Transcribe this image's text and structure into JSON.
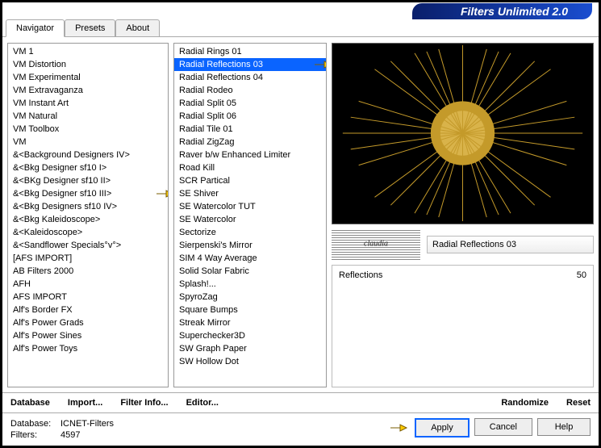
{
  "brand": "Filters Unlimited 2.0",
  "tabs": [
    "Navigator",
    "Presets",
    "About"
  ],
  "active_tab": "Navigator",
  "categories": [
    "VM 1",
    "VM Distortion",
    "VM Experimental",
    "VM Extravaganza",
    "VM Instant Art",
    "VM Natural",
    "VM Toolbox",
    "VM",
    "&<Background Designers IV>",
    "&<Bkg Designer sf10 I>",
    "&<BKg Designer sf10 II>",
    "&<Bkg Designer sf10 III>",
    "&<Bkg Designers sf10 IV>",
    "&<Bkg Kaleidoscope>",
    "&<Kaleidoscope>",
    "&<Sandflower Specials°v°>",
    "[AFS IMPORT]",
    "AB Filters 2000",
    "AFH",
    "AFS IMPORT",
    "Alf's Border FX",
    "Alf's Power Grads",
    "Alf's Power Sines",
    "Alf's Power Toys"
  ],
  "selected_category_index": 11,
  "filters": [
    "Radial  Rings 01",
    "Radial Reflections 03",
    "Radial Reflections 04",
    "Radial Rodeo",
    "Radial Split 05",
    "Radial Split 06",
    "Radial Tile 01",
    "Radial ZigZag",
    "Raver b/w Enhanced Limiter",
    "Road Kill",
    "SCR  Partical",
    "SE Shiver",
    "SE Watercolor TUT",
    "SE Watercolor",
    "Sectorize",
    "Sierpenski's Mirror",
    "SIM 4 Way Average",
    "Solid Solar Fabric",
    "Splash!...",
    "SpyroZag",
    "Square Bumps",
    "Streak Mirror",
    "Superchecker3D",
    "SW Graph Paper",
    "SW Hollow Dot"
  ],
  "selected_filter_index": 1,
  "selected_filter_name": "Radial Reflections 03",
  "params": [
    {
      "label": "Reflections",
      "value": 50
    }
  ],
  "footer_buttons": {
    "database": "Database",
    "import": "Import...",
    "filter_info": "Filter Info...",
    "editor": "Editor...",
    "randomize": "Randomize",
    "reset": "Reset"
  },
  "status": {
    "db_label": "Database:",
    "db_value": "ICNET-Filters",
    "filters_label": "Filters:",
    "filters_value": "4597"
  },
  "actions": {
    "apply": "Apply",
    "cancel": "Cancel",
    "help": "Help"
  }
}
